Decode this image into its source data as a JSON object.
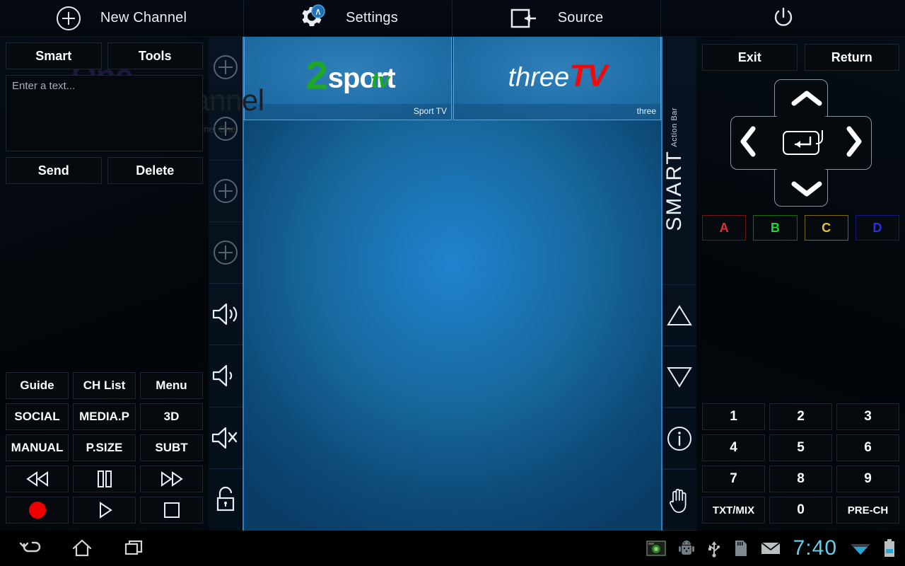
{
  "topbar": {
    "items": [
      {
        "icon": "plus-circle-icon",
        "label": "New Channel"
      },
      {
        "icon": "settings-gear-icon",
        "badge": "∧",
        "label": "Settings"
      },
      {
        "icon": "source-input-icon",
        "label": "Source"
      },
      {
        "icon": "power-icon",
        "label": ""
      }
    ]
  },
  "left_panel": {
    "smart_label": "Smart",
    "tools_label": "Tools",
    "text_input": {
      "value": "",
      "placeholder": "Enter a text..."
    },
    "send_label": "Send",
    "delete_label": "Delete",
    "watermark": {
      "one": "One",
      "channel": "channel",
      "caption": "Channel One"
    },
    "keypad": [
      {
        "label": "Guide",
        "type": "text"
      },
      {
        "label": "CH List",
        "type": "text"
      },
      {
        "label": "Menu",
        "type": "text"
      },
      {
        "label": "SOCIAL",
        "type": "text"
      },
      {
        "label": "MEDIA.P",
        "type": "text"
      },
      {
        "label": "3D",
        "type": "text"
      },
      {
        "label": "MANUAL",
        "type": "text"
      },
      {
        "label": "P.SIZE",
        "type": "text"
      },
      {
        "label": "SUBT",
        "type": "text"
      },
      {
        "label": "rewind-icon",
        "type": "icon"
      },
      {
        "label": "pause-icon",
        "type": "icon"
      },
      {
        "label": "fast-forward-icon",
        "type": "icon"
      },
      {
        "label": "record-icon",
        "type": "icon"
      },
      {
        "label": "play-icon",
        "type": "icon"
      },
      {
        "label": "stop-icon",
        "type": "icon"
      }
    ]
  },
  "left_rail": {
    "items": [
      "plus-circle-icon",
      "plus-circle-icon",
      "plus-circle-icon",
      "plus-circle-icon",
      "volume-up-icon",
      "volume-down-icon",
      "volume-mute-icon",
      "lock-open-icon"
    ]
  },
  "main": {
    "channels": [
      {
        "caption": "Sport TV",
        "logo_parts": [
          {
            "text": "2",
            "color": "#1fa828"
          },
          {
            "text": "sport",
            "color": "#ffffff"
          },
          {
            "text": "tv",
            "color": "#1fa828"
          }
        ]
      },
      {
        "caption": "three",
        "logo_parts": [
          {
            "text": "three",
            "color": "#ffffff"
          },
          {
            "text": "TV",
            "color": "#ee0b0b"
          }
        ]
      }
    ]
  },
  "right_rail": {
    "brand_main": "SMART",
    "brand_sub": "Action Bar",
    "items": [
      "channel-up-triangle-icon",
      "channel-down-triangle-icon",
      "info-icon",
      "hand-icon"
    ]
  },
  "right_panel": {
    "exit_label": "Exit",
    "return_label": "Return",
    "dpad": {
      "up": "up-arrow-icon",
      "down": "down-arrow-icon",
      "left": "left-arrow-icon",
      "right": "right-arrow-icon",
      "center": "enter-icon"
    },
    "color_buttons": [
      {
        "label": "A",
        "color": "#e0312f",
        "border": "#6b1714"
      },
      {
        "label": "B",
        "color": "#1fd82b",
        "border": "#136b18"
      },
      {
        "label": "C",
        "color": "#ecc221",
        "border": "#7c6612"
      },
      {
        "label": "D",
        "color": "#2a2ff0",
        "border": "#151a7a"
      }
    ],
    "numpad": [
      "1",
      "2",
      "3",
      "4",
      "5",
      "6",
      "7",
      "8",
      "9",
      "TXT/MIX",
      "0",
      "PRE-CH"
    ]
  },
  "navbar": {
    "back": "back-icon",
    "home": "home-icon",
    "recents": "recents-icon",
    "status_icons": [
      "screenshot-icon",
      "android-debug-icon",
      "usb-icon",
      "sdcard-icon",
      "mail-icon"
    ],
    "clock": "7:40",
    "wifi": "wifi-icon",
    "battery": "battery-icon"
  },
  "colors": {
    "accent_blue": "#2c7fc7",
    "clock_cyan": "#5fd0ef",
    "record_red": "#ef0000"
  }
}
